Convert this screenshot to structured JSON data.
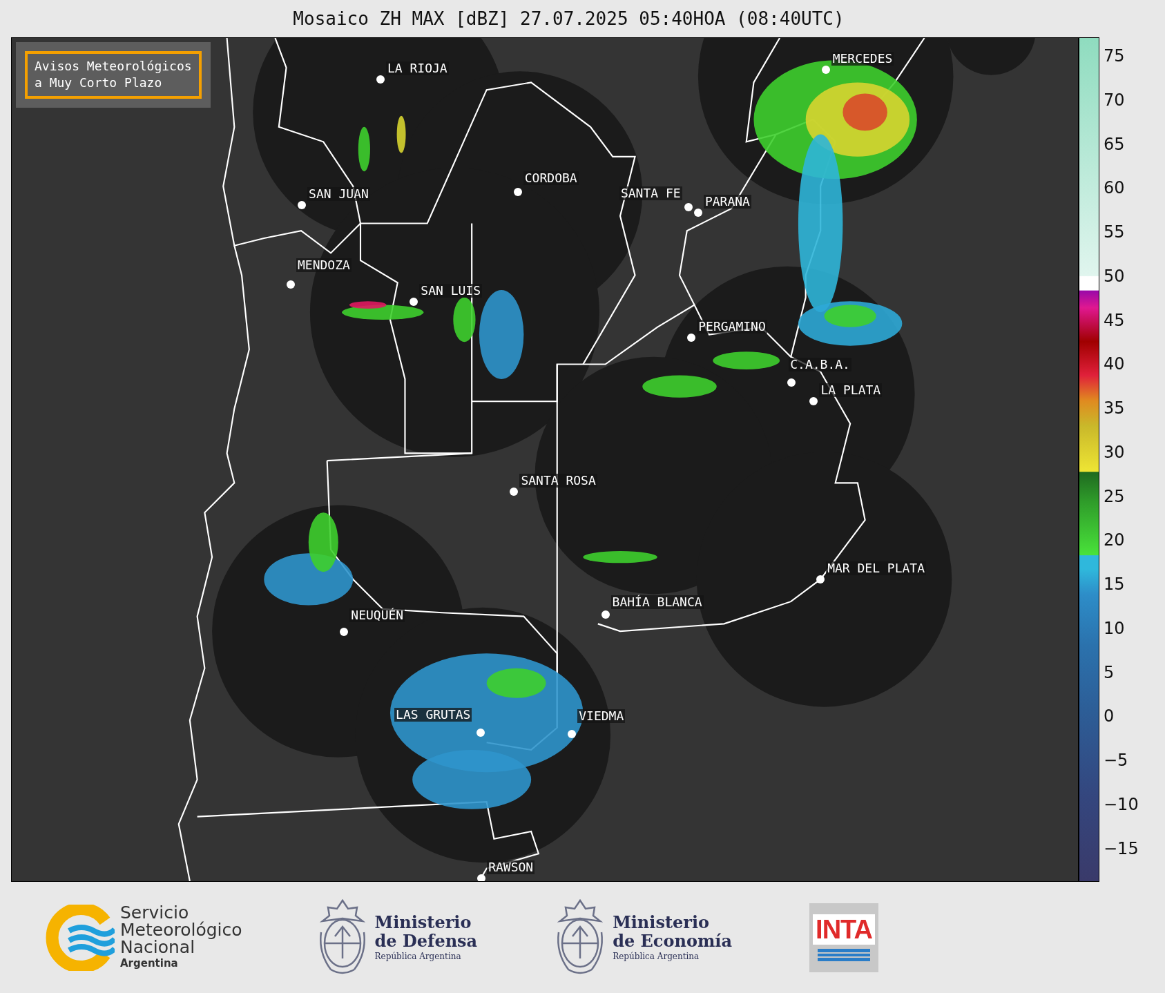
{
  "title": "Mosaico ZH MAX [dBZ] 27.07.2025 05:40HOA (08:40UTC)",
  "notice": {
    "lines": [
      "Avisos Meteorológicos",
      "a Muy Corto Plazo"
    ]
  },
  "cities": [
    "LA RIOJA",
    "SAN JUAN",
    "CORDOBA",
    "SANTA FE",
    "PARANA",
    "MERCEDES",
    "MENDOZA",
    "SAN LUIS",
    "PERGAMINO",
    "C.A.B.A.",
    "LA PLATA",
    "SANTA ROSA",
    "MAR DEL PLATA",
    "BAHÍA BLANCA",
    "NEUQUÉN",
    "LAS GRUTAS",
    "VIEDMA",
    "RAWSON"
  ],
  "colorbar": {
    "ticks": [
      "75",
      "70",
      "65",
      "60",
      "55",
      "50",
      "45",
      "40",
      "35",
      "30",
      "25",
      "20",
      "15",
      "10",
      "5",
      "0",
      "−5",
      "−10",
      "−15"
    ]
  },
  "footer": {
    "smn": {
      "lines": [
        "Servicio",
        "Meteorológico",
        "Nacional"
      ],
      "country": "Argentina"
    },
    "ministries": [
      {
        "line1": "Ministerio",
        "line2": "de Defensa",
        "country": "República Argentina"
      },
      {
        "line1": "Ministerio",
        "line2": "de Economía",
        "country": "República Argentina"
      }
    ],
    "inta": "INTA"
  }
}
